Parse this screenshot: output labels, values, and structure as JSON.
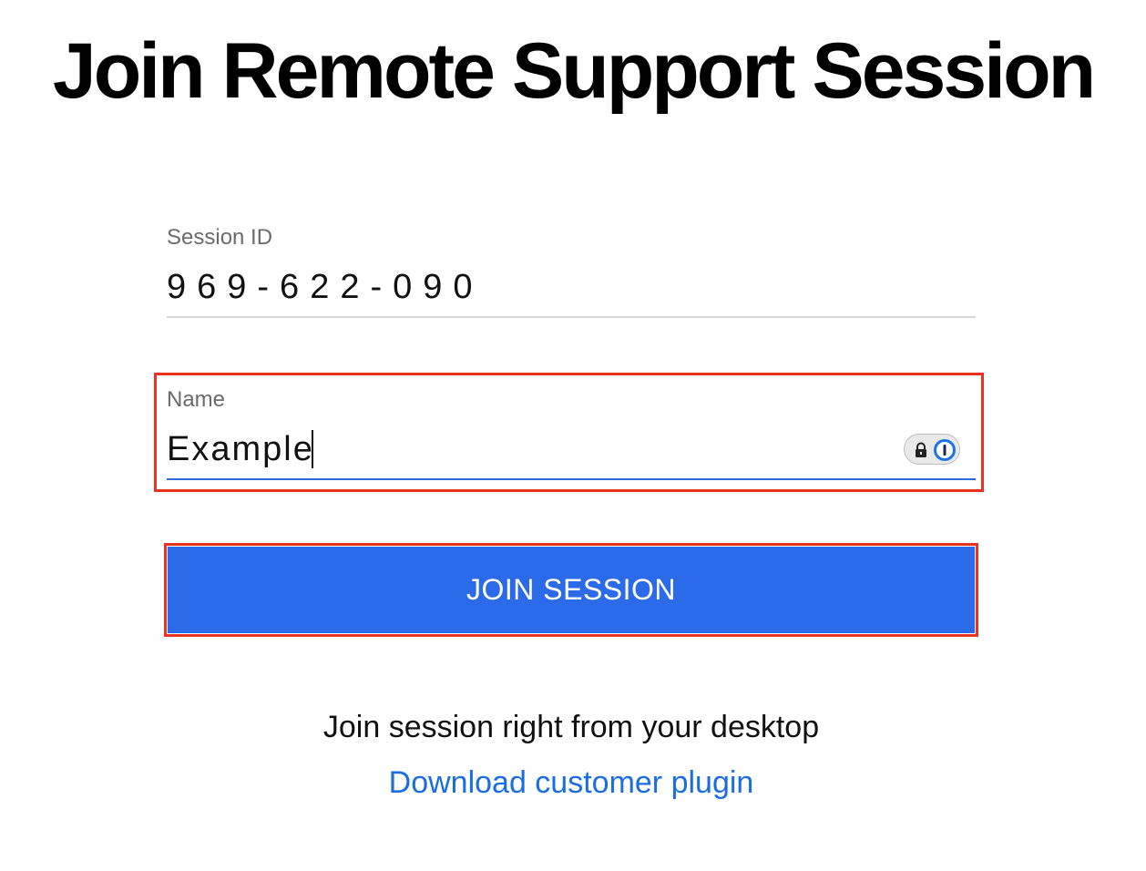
{
  "page": {
    "title": "Join Remote Support Session"
  },
  "form": {
    "session_id": {
      "label": "Session ID",
      "value": "969-622-090"
    },
    "name": {
      "label": "Name",
      "value": "Example"
    },
    "join_button_label": "JOIN SESSION"
  },
  "footer": {
    "desktop_text": "Join session right from your desktop",
    "plugin_link": "Download customer plugin"
  },
  "icons": {
    "password_manager_lock": "lock-icon",
    "password_manager_logo": "onepassword-icon"
  },
  "colors": {
    "primary_button": "#2b6ae8",
    "link": "#1a6de3",
    "highlight_border": "#ea3323",
    "active_underline": "#2b6ad8"
  }
}
